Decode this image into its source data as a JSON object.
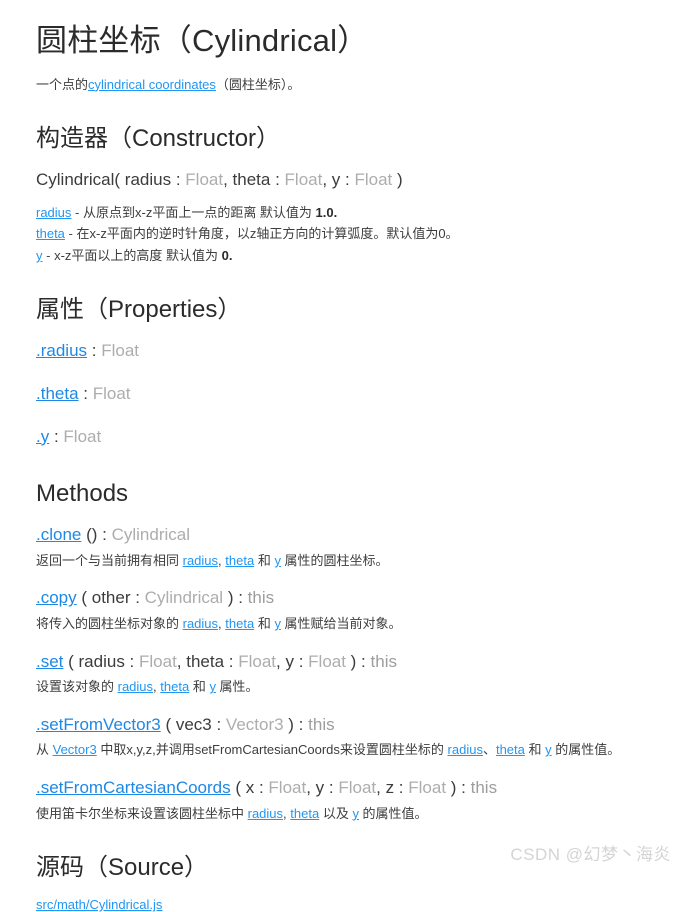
{
  "title": "圆柱坐标（Cylindrical）",
  "lead": {
    "pre": "一个点的",
    "link": "cylindrical coordinates",
    "post": "（圆柱坐标）。"
  },
  "constructor": {
    "heading": "构造器（Constructor）",
    "signature": {
      "name": "Cylindrical(",
      "params": [
        {
          "name": "radius",
          "sep": " : ",
          "type": "Float",
          "tail": ","
        },
        {
          "name": "theta",
          "sep": " : ",
          "type": "Float",
          "tail": ","
        },
        {
          "name": "y",
          "sep": " : ",
          "type": "Float",
          "tail": ""
        }
      ],
      "close": ")"
    },
    "params": [
      {
        "name": "radius",
        "dash": " - ",
        "text": "从原点到x-z平面上一点的距离 默认值为 ",
        "value": "1.0."
      },
      {
        "name": "theta",
        "dash": " - ",
        "text": "在x-z平面内的逆时针角度，以z轴正方向的计算弧度。默认值为0。",
        "value": ""
      },
      {
        "name": "y",
        "dash": " - ",
        "text": "x-z平面以上的高度 默认值为 ",
        "value": "0."
      }
    ]
  },
  "properties": {
    "heading": "属性（Properties）",
    "items": [
      {
        "name": ".radius",
        "sep": " : ",
        "type": "Float"
      },
      {
        "name": ".theta",
        "sep": " : ",
        "type": "Float"
      },
      {
        "name": ".y",
        "sep": " : ",
        "type": "Float"
      }
    ]
  },
  "methods": {
    "heading": "Methods",
    "items": [
      {
        "name": ".clone",
        "open": " ()",
        "sep": " : ",
        "ret": "Cylindrical",
        "ret_style": "type",
        "args": [],
        "desc": [
          {
            "t": "返回一个与当前拥有相同 ",
            "c": "plain"
          },
          {
            "t": "radius",
            "c": "link"
          },
          {
            "t": ", ",
            "c": "plain"
          },
          {
            "t": "theta",
            "c": "link"
          },
          {
            "t": " 和 ",
            "c": "plain"
          },
          {
            "t": "y",
            "c": "link"
          },
          {
            "t": " 属性的圆柱坐标。",
            "c": "plain"
          }
        ]
      },
      {
        "name": ".copy",
        "open": " ( ",
        "sep": " ) : ",
        "ret": "this",
        "ret_style": "this",
        "args": [
          {
            "name": "other",
            "sep": " : ",
            "type": "Cylindrical",
            "tail": ""
          }
        ],
        "desc": [
          {
            "t": "将传入的圆柱坐标对象的 ",
            "c": "plain"
          },
          {
            "t": "radius",
            "c": "link"
          },
          {
            "t": ", ",
            "c": "plain"
          },
          {
            "t": "theta",
            "c": "link"
          },
          {
            "t": " 和 ",
            "c": "plain"
          },
          {
            "t": "y",
            "c": "link"
          },
          {
            "t": " 属性赋给当前对象。",
            "c": "plain"
          }
        ]
      },
      {
        "name": ".set",
        "open": " ( ",
        "sep": " ) : ",
        "ret": "this",
        "ret_style": "this",
        "args": [
          {
            "name": "radius",
            "sep": " : ",
            "type": "Float",
            "tail": ", "
          },
          {
            "name": "theta",
            "sep": " : ",
            "type": "Float",
            "tail": ", "
          },
          {
            "name": "y",
            "sep": " : ",
            "type": "Float",
            "tail": ""
          }
        ],
        "desc": [
          {
            "t": "设置该对象的 ",
            "c": "plain"
          },
          {
            "t": "radius",
            "c": "link"
          },
          {
            "t": ", ",
            "c": "plain"
          },
          {
            "t": "theta",
            "c": "link"
          },
          {
            "t": " 和 ",
            "c": "plain"
          },
          {
            "t": "y",
            "c": "link"
          },
          {
            "t": " 属性。",
            "c": "plain"
          }
        ]
      },
      {
        "name": ".setFromVector3",
        "open": " ( ",
        "sep": " ) : ",
        "ret": "this",
        "ret_style": "this",
        "args": [
          {
            "name": "vec3",
            "sep": " : ",
            "type": "Vector3",
            "tail": ""
          }
        ],
        "desc": [
          {
            "t": "从 ",
            "c": "plain"
          },
          {
            "t": "Vector3",
            "c": "link"
          },
          {
            "t": " 中取x,y,z,并调用setFromCartesianCoords来设置圆柱坐标的 ",
            "c": "plain"
          },
          {
            "t": "radius",
            "c": "link"
          },
          {
            "t": "、",
            "c": "plain"
          },
          {
            "t": "theta",
            "c": "link"
          },
          {
            "t": " 和 ",
            "c": "plain"
          },
          {
            "t": "y",
            "c": "link"
          },
          {
            "t": " 的属性值。",
            "c": "plain"
          }
        ]
      },
      {
        "name": ".setFromCartesianCoords",
        "open": " ( ",
        "sep": " ) : ",
        "ret": "this",
        "ret_style": "this",
        "args": [
          {
            "name": "x",
            "sep": " : ",
            "type": "Float",
            "tail": ", "
          },
          {
            "name": "y",
            "sep": " : ",
            "type": "Float",
            "tail": ", "
          },
          {
            "name": "z",
            "sep": " : ",
            "type": "Float",
            "tail": ""
          }
        ],
        "desc": [
          {
            "t": "使用笛卡尔坐标来设置该圆柱坐标中 ",
            "c": "plain"
          },
          {
            "t": "radius",
            "c": "link"
          },
          {
            "t": ", ",
            "c": "plain"
          },
          {
            "t": "theta",
            "c": "link"
          },
          {
            "t": " 以及 ",
            "c": "plain"
          },
          {
            "t": "y",
            "c": "link"
          },
          {
            "t": " 的属性值。",
            "c": "plain"
          }
        ]
      }
    ]
  },
  "source": {
    "heading": "源码（Source）",
    "link": "src/math/Cylindrical.js"
  },
  "watermark": "CSDN @幻梦丶海炎"
}
